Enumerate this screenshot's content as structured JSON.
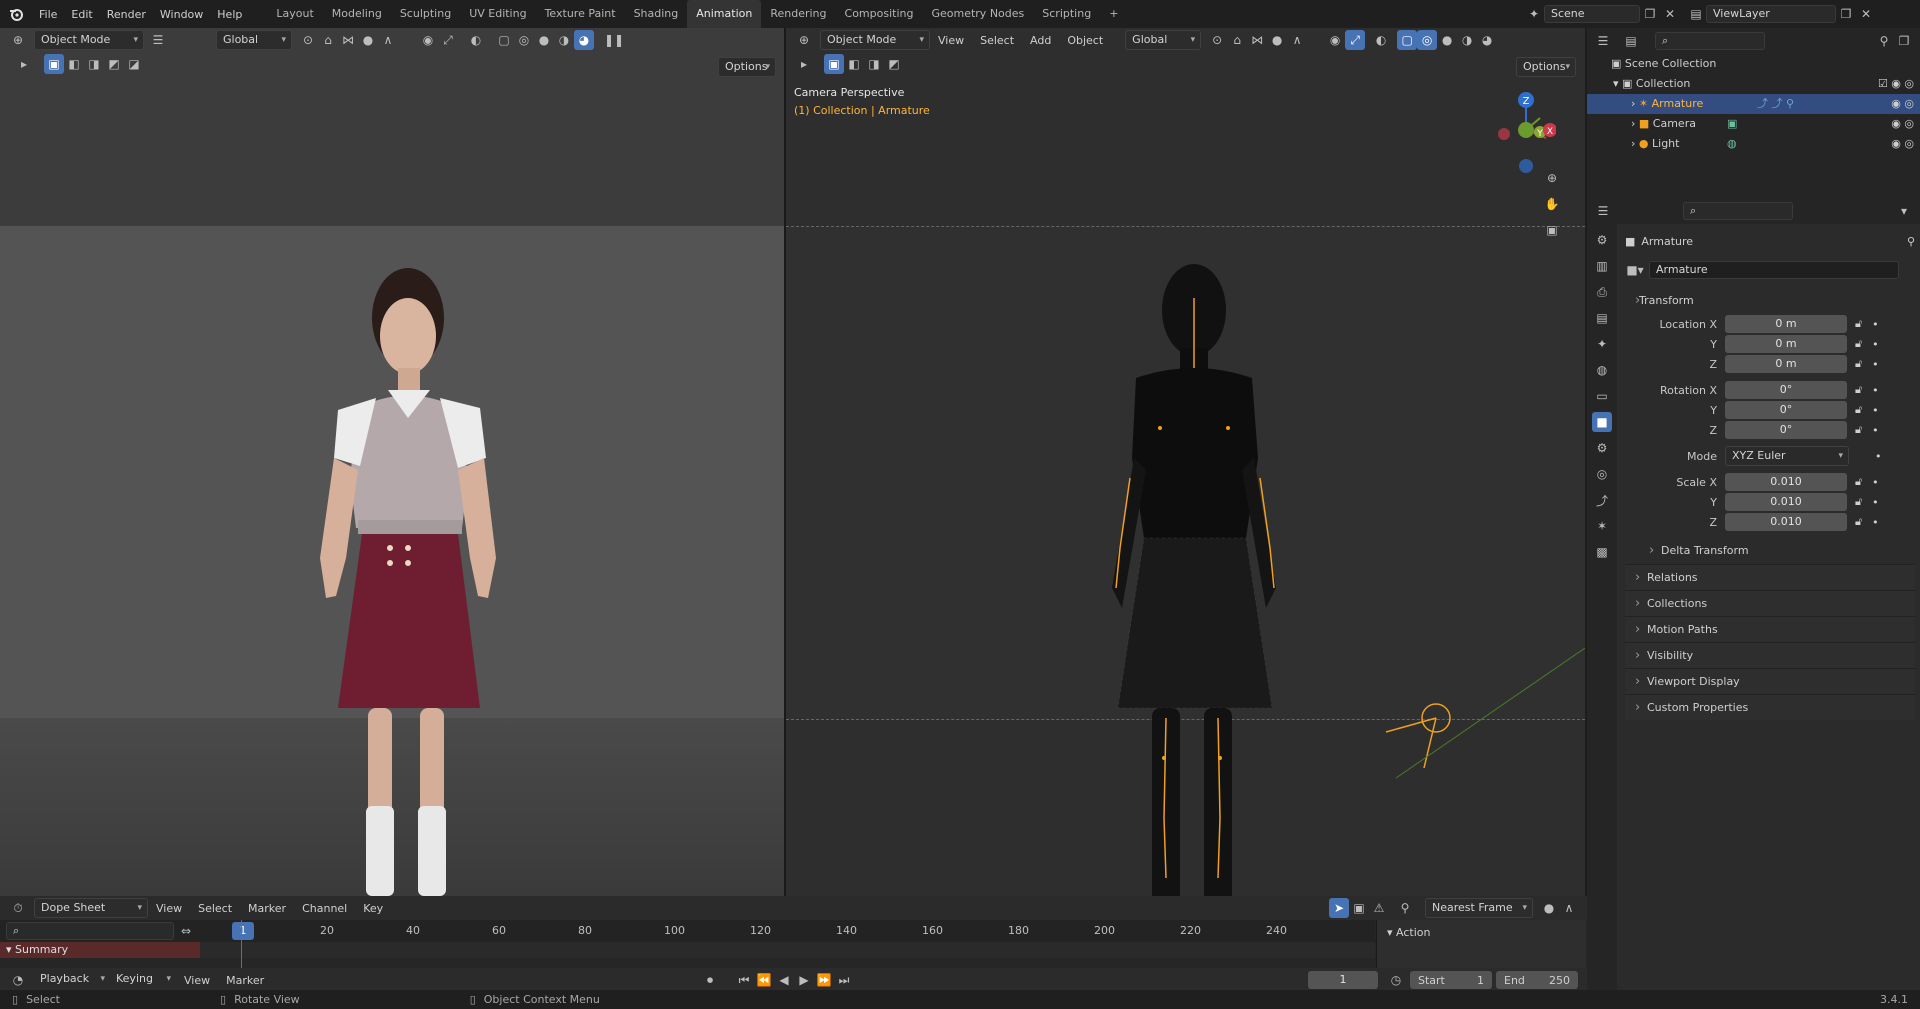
{
  "menu": [
    "File",
    "Edit",
    "Render",
    "Window",
    "Help"
  ],
  "workspaces": [
    "Layout",
    "Modeling",
    "Sculpting",
    "UV Editing",
    "Texture Paint",
    "Shading",
    "Animation",
    "Rendering",
    "Compositing",
    "Geometry Nodes",
    "Scripting"
  ],
  "active_workspace": "Animation",
  "scene_name": "Scene",
  "view_layer": "ViewLayer",
  "left_viewport": {
    "mode": "Object Mode",
    "orientation": "Global",
    "options": "Options"
  },
  "right_viewport": {
    "mode": "Object Mode",
    "menus": [
      "View",
      "Select",
      "Add",
      "Object"
    ],
    "orientation": "Global",
    "options": "Options",
    "overlay_title": "Camera Perspective",
    "overlay_sub": "(1) Collection | Armature",
    "gizmo": {
      "z": "Z",
      "y": "Y",
      "x": "X"
    }
  },
  "outliner": {
    "root": "Scene Collection",
    "collection": "Collection",
    "items": [
      "Armature",
      "Camera",
      "Light"
    ],
    "selected": "Armature"
  },
  "properties": {
    "object_name": "Armature",
    "data_name": "Armature",
    "transform_label": "Transform",
    "location_label": "Location X",
    "rotation_label": "Rotation X",
    "scale_label": "Scale X",
    "y_label": "Y",
    "z_label": "Z",
    "mode_label": "Mode",
    "location": [
      "0 m",
      "0 m",
      "0 m"
    ],
    "rotation": [
      "0°",
      "0°",
      "0°"
    ],
    "rotation_mode": "XYZ Euler",
    "scale": [
      "0.010",
      "0.010",
      "0.010"
    ],
    "delta": "Delta Transform",
    "panels": [
      "Relations",
      "Collections",
      "Motion Paths",
      "Visibility",
      "Viewport Display",
      "Custom Properties"
    ]
  },
  "dopesheet": {
    "editor": "Dope Sheet",
    "menus": [
      "View",
      "Select",
      "Marker",
      "Channel",
      "Key"
    ],
    "snap": "Nearest Frame",
    "summary": "Summary",
    "action": "Action",
    "current_frame_badge": "1",
    "ticks": [
      "20",
      "40",
      "60",
      "80",
      "100",
      "120",
      "140",
      "160",
      "180",
      "200",
      "220",
      "240"
    ]
  },
  "playback": {
    "menus": [
      "Playback",
      "Keying",
      "View",
      "Marker"
    ],
    "current_frame": "1",
    "start_label": "Start",
    "start": "1",
    "end_label": "End",
    "end": "250"
  },
  "status": {
    "select": "Select",
    "rotate": "Rotate View",
    "context": "Object Context Menu",
    "version": "3.4.1"
  },
  "colors": {
    "accent": "#4772b3",
    "active_orange": "#f0a020",
    "selection_text": "#ffb43a",
    "skirt": "#6e1e30"
  }
}
